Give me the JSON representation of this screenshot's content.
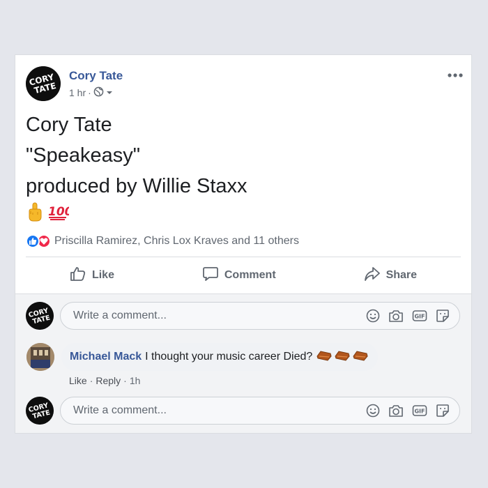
{
  "post": {
    "author": "Cory Tate",
    "time": "1 hr",
    "separator": "·",
    "more_icon": "more-options-icon",
    "text_lines": [
      "Cory Tate",
      "\"Speakeasy\"",
      "produced by Willie Staxx"
    ],
    "emojis": [
      "middle-finger-emoji",
      "hundred-points-emoji"
    ],
    "reactions_text": "Priscilla Ramirez, Chris Lox Kraves and 11 others"
  },
  "actions": {
    "like": "Like",
    "comment": "Comment",
    "share": "Share"
  },
  "composer": {
    "placeholder": "Write a comment..."
  },
  "comment": {
    "author": "Michael Mack",
    "text": "I thought your music career Died?",
    "emojis": [
      "coffin-emoji",
      "coffin-emoji",
      "coffin-emoji"
    ],
    "like": "Like",
    "reply": "Reply",
    "time": "1h",
    "separator": "·"
  },
  "colors": {
    "name_blue": "#385898",
    "like_blue": "#1877f2",
    "love_red": "#f0284a",
    "meta_gray": "#606770"
  }
}
